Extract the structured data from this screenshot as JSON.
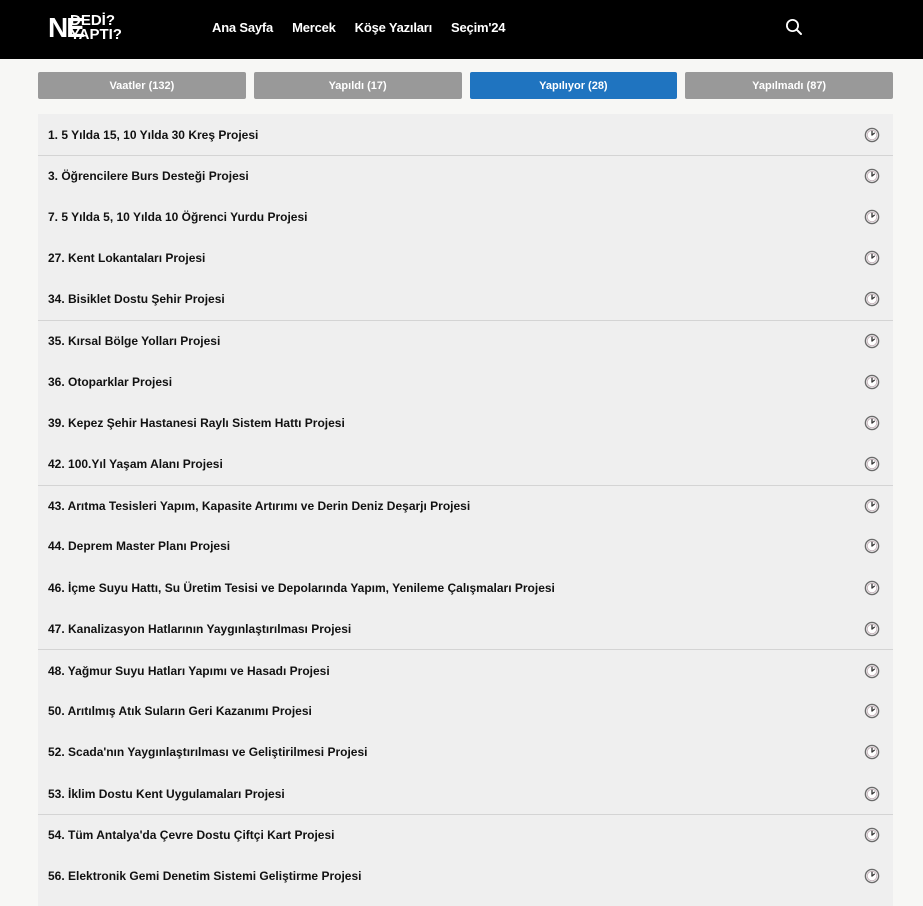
{
  "header": {
    "logo_ne": "NE",
    "logo_dedi": "DEDİ?",
    "logo_yapti": "YAPTI?",
    "nav": [
      "Ana Sayfa",
      "Mercek",
      "Köşe Yazıları",
      "Seçim'24"
    ],
    "search_icon": "search-icon"
  },
  "tabs": [
    {
      "label": "Vaatler (132)",
      "active": false
    },
    {
      "label": "Yapıldı (17)",
      "active": false
    },
    {
      "label": "Yapılıyor (28)",
      "active": true
    },
    {
      "label": "Yapılmadı (87)",
      "active": false
    }
  ],
  "colors": {
    "active_tab": "#1f74c0",
    "inactive_tab": "#999999",
    "header_bg": "#000000",
    "list_bg": "#efefef"
  },
  "items": [
    {
      "label": "1. 5 Yılda 15, 10 Yılda 30 Kreş Projesi",
      "status_icon": "in-progress-icon"
    },
    {
      "label": "3. Öğrencilere Burs Desteği Projesi",
      "status_icon": "in-progress-icon"
    },
    {
      "label": "7. 5 Yılda 5, 10 Yılda 10 Öğrenci Yurdu Projesi",
      "status_icon": "in-progress-icon"
    },
    {
      "label": "27. Kent Lokantaları Projesi",
      "status_icon": "in-progress-icon"
    },
    {
      "label": "34. Bisiklet Dostu Şehir Projesi",
      "status_icon": "in-progress-icon"
    },
    {
      "label": "35. Kırsal Bölge Yolları Projesi",
      "status_icon": "in-progress-icon"
    },
    {
      "label": "36. Otoparklar Projesi",
      "status_icon": "in-progress-icon"
    },
    {
      "label": "39. Kepez Şehir Hastanesi Raylı Sistem Hattı Projesi",
      "status_icon": "in-progress-icon"
    },
    {
      "label": "42. 100.Yıl Yaşam Alanı Projesi",
      "status_icon": "in-progress-icon"
    },
    {
      "label": "43. Arıtma Tesisleri Yapım, Kapasite Artırımı ve Derin Deniz Deşarjı Projesi",
      "status_icon": "in-progress-icon"
    },
    {
      "label": "44. Deprem Master Planı Projesi",
      "status_icon": "in-progress-icon"
    },
    {
      "label": "46. İçme Suyu Hattı, Su Üretim Tesisi ve Depolarında Yapım, Yenileme Çalışmaları Projesi",
      "status_icon": "in-progress-icon"
    },
    {
      "label": "47. Kanalizasyon Hatlarının Yaygınlaştırılması Projesi",
      "status_icon": "in-progress-icon"
    },
    {
      "label": "48. Yağmur Suyu Hatları Yapımı ve Hasadı Projesi",
      "status_icon": "in-progress-icon"
    },
    {
      "label": "50. Arıtılmış Atık Suların Geri Kazanımı Projesi",
      "status_icon": "in-progress-icon"
    },
    {
      "label": "52. Scada'nın Yaygınlaştırılması ve Geliştirilmesi Projesi",
      "status_icon": "in-progress-icon"
    },
    {
      "label": "53. İklim Dostu Kent Uygulamaları Projesi",
      "status_icon": "in-progress-icon"
    },
    {
      "label": "54. Tüm Antalya'da Çevre Dostu Çiftçi Kart Projesi",
      "status_icon": "in-progress-icon"
    },
    {
      "label": "56. Elektronik Gemi Denetim Sistemi Geliştirme Projesi",
      "status_icon": "in-progress-icon"
    }
  ]
}
